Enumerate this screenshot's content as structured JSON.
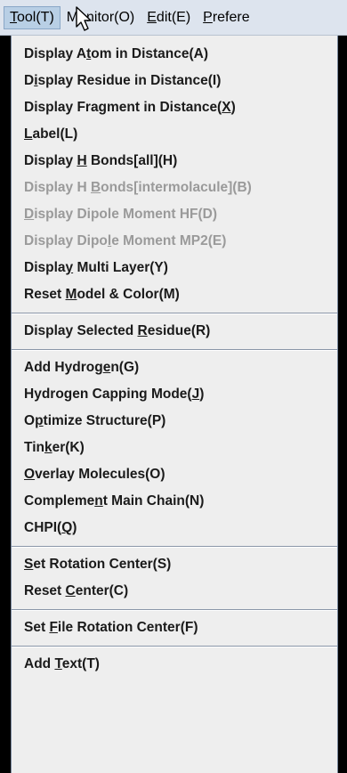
{
  "menubar": {
    "items": [
      {
        "label": "Tool(T)",
        "mnemonic_index": 0
      },
      {
        "label": "Monitor(O)",
        "mnemonic_index": 1
      },
      {
        "label": "Edit(E)",
        "mnemonic_index": 0
      },
      {
        "label": "Prefere",
        "mnemonic_index": 0
      }
    ]
  },
  "menu": {
    "groups": [
      [
        {
          "label": "Display Atom in Distance(A)",
          "mnemonic": "a",
          "mnemonic_index": 9,
          "enabled": true
        },
        {
          "label": "Display Residue in Distance(I)",
          "mnemonic": "i",
          "mnemonic_index": 1,
          "enabled": true
        },
        {
          "label": "Display Fragment in Distance(X)",
          "mnemonic": "X",
          "mnemonic_index": 29,
          "enabled": true
        },
        {
          "label": "Label(L)",
          "mnemonic": "L",
          "mnemonic_index": 0,
          "enabled": true
        },
        {
          "label": "Display H Bonds[all](H)",
          "mnemonic": "H",
          "mnemonic_index": 8,
          "enabled": true
        },
        {
          "label": "Display H Bonds[intermolacule](B)",
          "mnemonic": "B",
          "mnemonic_index": 10,
          "enabled": false
        },
        {
          "label": "Display Dipole Moment HF(D)",
          "mnemonic": "D",
          "mnemonic_index": 0,
          "enabled": false
        },
        {
          "label": "Display Dipole Moment MP2(E)",
          "mnemonic": "e",
          "mnemonic_index": 12,
          "enabled": false
        },
        {
          "label": "Display Multi Layer(Y)",
          "mnemonic": "y",
          "mnemonic_index": 6,
          "enabled": true
        },
        {
          "label": "Reset Model & Color(M)",
          "mnemonic": "M",
          "mnemonic_index": 6,
          "enabled": true
        }
      ],
      [
        {
          "label": "Display Selected Residue(R)",
          "mnemonic": "R",
          "mnemonic_index": 17,
          "enabled": true
        }
      ],
      [
        {
          "label": "Add Hydrogen(G)",
          "mnemonic": "g",
          "mnemonic_index": 10,
          "enabled": true
        },
        {
          "label": "Hydrogen Capping Mode(J)",
          "mnemonic": "J",
          "mnemonic_index": 22,
          "enabled": true
        },
        {
          "label": "Optimize Structure(P)",
          "mnemonic": "p",
          "mnemonic_index": 1,
          "enabled": true
        },
        {
          "label": "Tinker(K)",
          "mnemonic": "k",
          "mnemonic_index": 3,
          "enabled": true
        },
        {
          "label": "Overlay Molecules(O)",
          "mnemonic": "O",
          "mnemonic_index": 0,
          "enabled": true
        },
        {
          "label": "Complement Main Chain(N)",
          "mnemonic": "n",
          "mnemonic_index": 8,
          "enabled": true
        },
        {
          "label": "CHPI(Q)",
          "mnemonic": "Q",
          "mnemonic_index": 5,
          "enabled": true
        }
      ],
      [
        {
          "label": "Set Rotation Center(S)",
          "mnemonic": "S",
          "mnemonic_index": 0,
          "enabled": true
        },
        {
          "label": "Reset Center(C)",
          "mnemonic": "C",
          "mnemonic_index": 6,
          "enabled": true
        }
      ],
      [
        {
          "label": "Set File Rotation Center(F)",
          "mnemonic": "F",
          "mnemonic_index": 4,
          "enabled": true
        }
      ],
      [
        {
          "label": "Add Text(T)",
          "mnemonic": "T",
          "mnemonic_index": 4,
          "enabled": true
        }
      ]
    ]
  },
  "colors": {
    "menubar_bg": "#dde4ee",
    "active_menu_bg": "#b8cfe5",
    "dropdown_bg": "#eeeeee",
    "enabled_text": "#1a1a1a",
    "disabled_text": "#9a9a9a",
    "backdrop": "#000000"
  },
  "icons": {
    "cursor": "arrow-pointer-icon"
  }
}
